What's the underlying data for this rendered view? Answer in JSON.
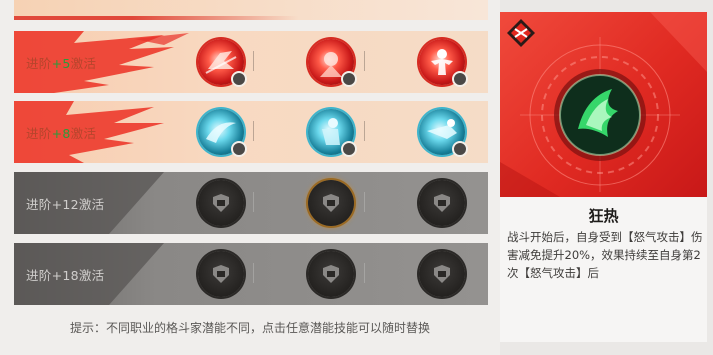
{
  "rows": [
    {
      "label_prefix": "进阶",
      "label_num": "+5",
      "label_suffix": "激活",
      "locked": false
    },
    {
      "label_prefix": "进阶",
      "label_num": "+8",
      "label_suffix": "激活",
      "locked": false
    },
    {
      "label": "进阶+12激活",
      "locked": true
    },
    {
      "label": "进阶+18激活",
      "locked": true
    }
  ],
  "tip": "提示：不同职业的格斗家潜能不同，点击任意潜能技能可以随时替换",
  "detail": {
    "name": "狂热",
    "description": "战斗开始后，自身受到【怒气攻击】伤害减免提升20%，效果持续至自身第2次【怒气攻击】后"
  },
  "colors": {
    "accent_red": "#e0281f",
    "active_green": "#2e9a3a",
    "cyan": "#3fb4cc",
    "locked_bg": "#8a8886"
  }
}
